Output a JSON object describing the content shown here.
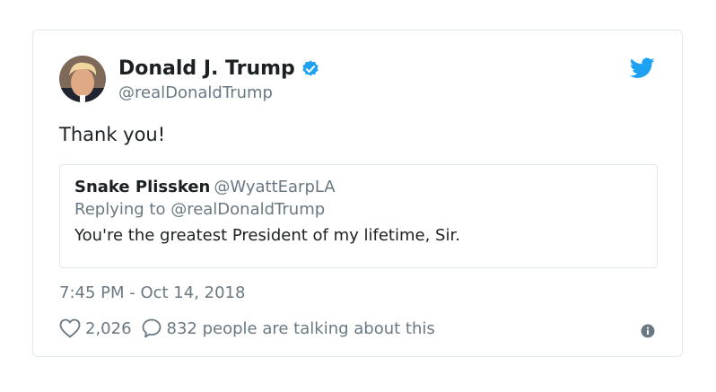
{
  "tweet": {
    "author": {
      "name": "Donald J. Trump",
      "handle": "@realDonaldTrump",
      "verified": true,
      "verified_color": "#1da1f2"
    },
    "text": "Thank you!",
    "quoted": {
      "name": "Snake Plissken",
      "handle": "@WyattEarpLA",
      "reply_context": "Replying to @realDonaldTrump",
      "text": "You're the greatest President of my lifetime, Sir."
    },
    "timestamp": "7:45 PM - Oct 14, 2018",
    "likes": "2,026",
    "conversation": "832 people are talking about this"
  },
  "icons": {
    "brand": "twitter-bird-icon",
    "brand_color": "#1da1f2",
    "like": "heart-icon",
    "reply": "speech-bubble-icon",
    "info": "info-icon"
  }
}
